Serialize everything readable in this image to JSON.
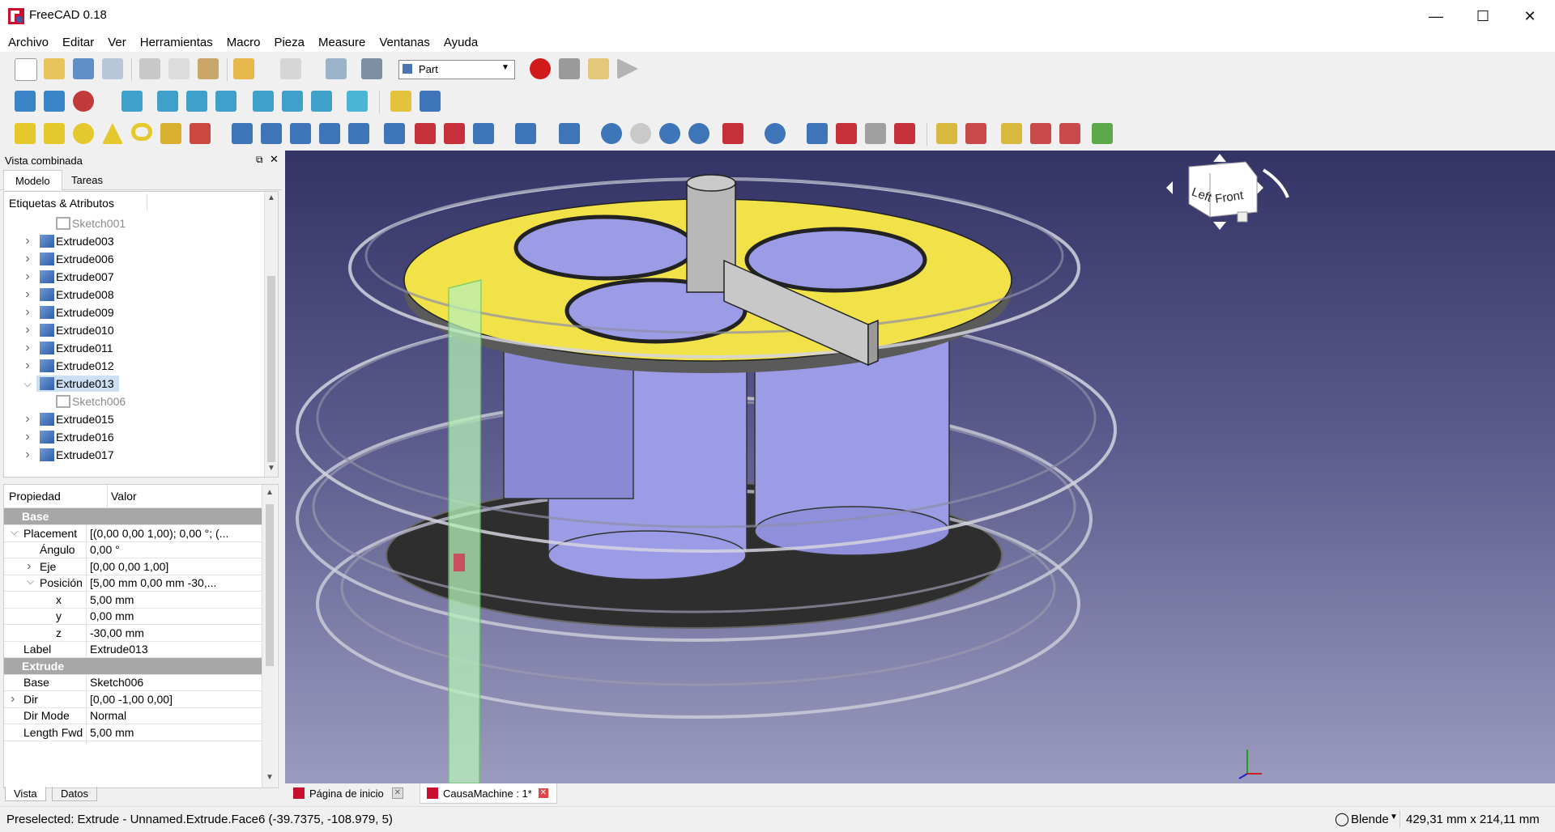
{
  "window": {
    "title": "FreeCAD 0.18"
  },
  "menu": [
    "Archivo",
    "Editar",
    "Ver",
    "Herramientas",
    "Macro",
    "Pieza",
    "Measure",
    "Ventanas",
    "Ayuda"
  ],
  "workbench": {
    "selected": "Part"
  },
  "colors": {
    "accent_red": "#d11a1a",
    "selection": "#cde0f3",
    "group_header": "#a7a7a7",
    "yellow_face": "#f2e24a",
    "cylinder_face": "#9c9ce6"
  },
  "combo_view": {
    "title": "Vista combinada",
    "tabs": [
      "Modelo",
      "Tareas"
    ],
    "tree_header": "Etiquetas & Atributos",
    "tree_items": [
      {
        "label": "Sketch001",
        "indent": 2,
        "type": "sketch"
      },
      {
        "label": "Extrude003",
        "indent": 1,
        "type": "extrude"
      },
      {
        "label": "Extrude006",
        "indent": 1,
        "type": "extrude"
      },
      {
        "label": "Extrude007",
        "indent": 1,
        "type": "extrude"
      },
      {
        "label": "Extrude008",
        "indent": 1,
        "type": "extrude"
      },
      {
        "label": "Extrude009",
        "indent": 1,
        "type": "extrude"
      },
      {
        "label": "Extrude010",
        "indent": 1,
        "type": "extrude"
      },
      {
        "label": "Extrude011",
        "indent": 1,
        "type": "extrude"
      },
      {
        "label": "Extrude012",
        "indent": 1,
        "type": "extrude"
      },
      {
        "label": "Extrude013",
        "indent": 1,
        "type": "extrude",
        "selected": true,
        "expanded": true
      },
      {
        "label": "Sketch006",
        "indent": 2,
        "type": "sketch"
      },
      {
        "label": "Extrude015",
        "indent": 1,
        "type": "extrude"
      },
      {
        "label": "Extrude016",
        "indent": 1,
        "type": "extrude"
      },
      {
        "label": "Extrude017",
        "indent": 1,
        "type": "extrude"
      }
    ]
  },
  "properties": {
    "header": {
      "name": "Propiedad",
      "value": "Valor"
    },
    "rows": [
      {
        "kind": "group",
        "name": "Base"
      },
      {
        "kind": "prop",
        "name": "Placement",
        "value": "[(0,00 0,00 1,00); 0,00 °; (...",
        "level": 0,
        "expander": "open"
      },
      {
        "kind": "prop",
        "name": "Ángulo",
        "value": "0,00 °",
        "level": 1
      },
      {
        "kind": "prop",
        "name": "Eje",
        "value": "[0,00 0,00 1,00]",
        "level": 1,
        "expander": "closed"
      },
      {
        "kind": "prop",
        "name": "Posición",
        "value": "[5,00 mm  0,00 mm  -30,...",
        "level": 1,
        "expander": "open"
      },
      {
        "kind": "prop",
        "name": "x",
        "value": "5,00 mm",
        "level": 2
      },
      {
        "kind": "prop",
        "name": "y",
        "value": "0,00 mm",
        "level": 2
      },
      {
        "kind": "prop",
        "name": "z",
        "value": "-30,00 mm",
        "level": 2
      },
      {
        "kind": "prop",
        "name": "Label",
        "value": "Extrude013",
        "level": 0
      },
      {
        "kind": "group",
        "name": "Extrude"
      },
      {
        "kind": "prop",
        "name": "Base",
        "value": "Sketch006",
        "level": 0
      },
      {
        "kind": "prop",
        "name": "Dir",
        "value": "[0,00 -1,00 0,00]",
        "level": 0,
        "expander": "closed"
      },
      {
        "kind": "prop",
        "name": "Dir Mode",
        "value": "Normal",
        "level": 0
      },
      {
        "kind": "prop",
        "name": "Length Fwd",
        "value": "5,00 mm",
        "level": 0
      }
    ],
    "bottom_tabs": [
      "Vista",
      "Datos"
    ]
  },
  "navcube": {
    "left_label": "Left",
    "front_label": "Front"
  },
  "documents": [
    {
      "label": "Página de inicio",
      "active": false
    },
    {
      "label": "CausaMachine : 1*",
      "active": true
    }
  ],
  "status": {
    "message": "Preselected: Extrude - Unnamed.Extrude.Face6 (-39.7375, -108.979, 5)",
    "nav_style": "Blende",
    "dimensions": "429,31 mm x 214,11 mm"
  }
}
